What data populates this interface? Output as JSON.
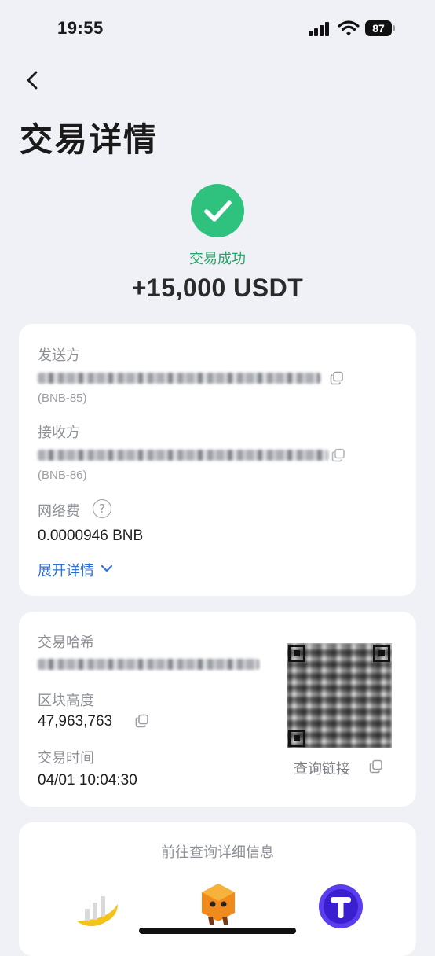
{
  "status_bar": {
    "time": "19:55",
    "battery": "87"
  },
  "header": {
    "title": "交易详情"
  },
  "summary": {
    "status": "交易成功",
    "amount": "+15,000 USDT",
    "status_color": "#2fc17e"
  },
  "transfer": {
    "sender_label": "发送方",
    "sender_network": "(BNB-85)",
    "receiver_label": "接收方",
    "receiver_network": "(BNB-86)",
    "fee_label": "网络费",
    "fee_help": "?",
    "fee_value": "0.0000946 BNB",
    "expand_label": "展开详情"
  },
  "chain_info": {
    "hash_label": "交易哈希",
    "block_label": "区块高度",
    "block_value": "47,963,763",
    "time_label": "交易时间",
    "time_value": "04/01 10:04:30",
    "query_link_label": "查询链接"
  },
  "explorers": {
    "title": "前往查询详细信息"
  },
  "colors": {
    "accent_blue": "#2f6fd6",
    "success_green": "#24a86a",
    "background": "#f0f1f6"
  }
}
